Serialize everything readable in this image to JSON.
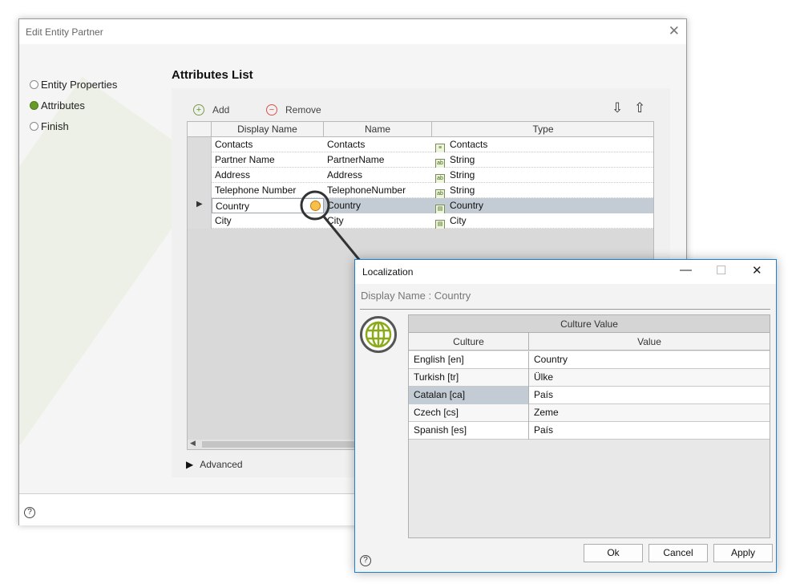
{
  "main_dialog": {
    "title": "Edit Entity Partner",
    "close_glyph": "✕",
    "nav": [
      {
        "label": "Entity Properties",
        "checked": false
      },
      {
        "label": "Attributes",
        "checked": true
      },
      {
        "label": "Finish",
        "checked": false
      }
    ],
    "section_title": "Attributes List",
    "toolbar": {
      "add_label": "Add",
      "remove_label": "Remove",
      "move_down_icon": "arrow-down-icon",
      "move_up_icon": "arrow-up-icon"
    },
    "grid": {
      "columns": [
        "Display Name",
        "Name",
        "Type"
      ],
      "rows": [
        {
          "display_name": "Contacts",
          "name": "Contacts",
          "type": "Contacts",
          "type_icon": "table-icon"
        },
        {
          "display_name": "Partner Name",
          "name": "PartnerName",
          "type": "String",
          "type_icon": "string-icon"
        },
        {
          "display_name": "Address",
          "name": "Address",
          "type": "String",
          "type_icon": "string-icon"
        },
        {
          "display_name": "Telephone Number",
          "name": "TelephoneNumber",
          "type": "String",
          "type_icon": "string-icon"
        },
        {
          "display_name": "Country",
          "name": "Country",
          "type": "Country",
          "type_icon": "list-icon",
          "selected": true
        },
        {
          "display_name": "City",
          "name": "City",
          "type": "City",
          "type_icon": "list-icon"
        }
      ]
    },
    "advanced_label": "Advanced",
    "help_glyph": "?"
  },
  "localization_dialog": {
    "title": "Localization",
    "subtitle": "Display Name : Country",
    "minimize_glyph": "—",
    "maximize_glyph": "☐",
    "close_glyph": "✕",
    "band_label": "Culture Value",
    "columns": [
      "Culture",
      "Value"
    ],
    "rows": [
      {
        "culture": "English [en]",
        "value": "Country"
      },
      {
        "culture": "Turkish [tr]",
        "value": "Ülke"
      },
      {
        "culture": "Catalan [ca]",
        "value": "País",
        "selected": true
      },
      {
        "culture": "Czech [cs]",
        "value": "Zeme"
      },
      {
        "culture": "Spanish [es]",
        "value": "País"
      }
    ],
    "buttons": {
      "ok": "Ok",
      "cancel": "Cancel",
      "apply": "Apply"
    },
    "help_glyph": "?"
  },
  "colors": {
    "accent_green": "#6a9a2a",
    "selection": "#c3cbd4",
    "dialog_border": "#1d80d0"
  }
}
